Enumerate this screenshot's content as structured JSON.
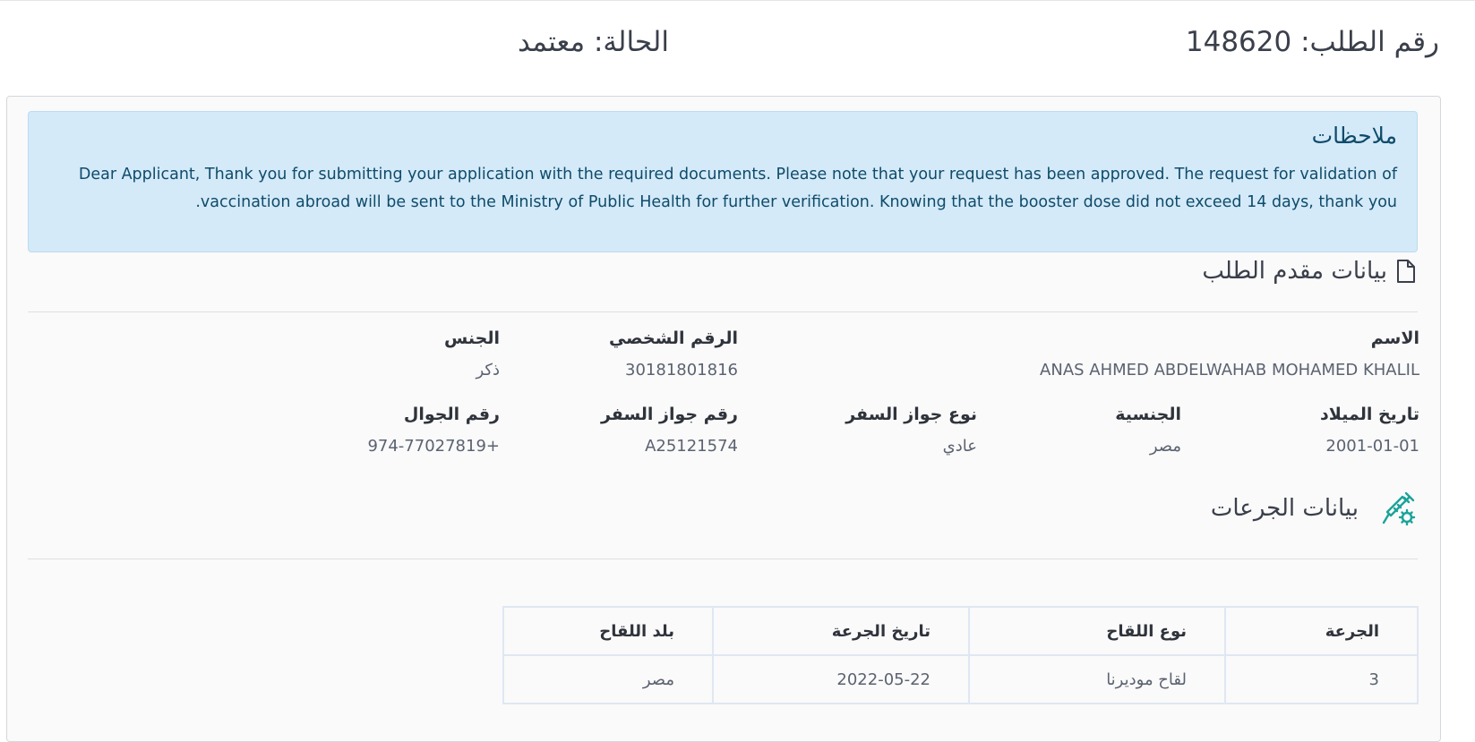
{
  "header": {
    "request_number": "رقم الطلب: 148620",
    "status": "الحالة: معتمد"
  },
  "notes": {
    "title": "ملاحظات",
    "body": "Dear Applicant, Thank you for submitting your application with the required documents. Please note that your request has been approved. The request for validation of vaccination abroad will be sent to the Ministry of Public Health for further verification. Knowing that the booster dose did not exceed 14 days, thank you."
  },
  "applicant": {
    "section_title": "بيانات مقدم الطلب",
    "icon": "document-icon",
    "fields": {
      "name": {
        "label": "الاسم",
        "value": "ANAS AHMED ABDELWAHAB MOHAMED KHALIL"
      },
      "personal_id": {
        "label": "الرقم الشخصي",
        "value": "30181801816"
      },
      "gender": {
        "label": "الجنس",
        "value": "ذكر"
      },
      "birth_date": {
        "label": "تاريخ الميلاد",
        "value": "2001-01-01"
      },
      "nationality": {
        "label": "الجنسية",
        "value": "مصر"
      },
      "passport_type": {
        "label": "نوع جواز السفر",
        "value": "عادي"
      },
      "passport_number": {
        "label": "رقم جواز السفر",
        "value": "A25121574"
      },
      "mobile": {
        "label": "رقم الجوال",
        "value": "+974-77027819"
      }
    }
  },
  "doses": {
    "section_title": "بيانات الجرعات",
    "icon": "syringe-icon",
    "icon_color": "#1aa39a",
    "columns": [
      "الجرعة",
      "نوع اللقاح",
      "تاريخ الجرعة",
      "بلد اللقاح"
    ],
    "rows": [
      [
        "3",
        "لقاح موديرنا",
        "2022-05-22",
        "مصر"
      ]
    ]
  }
}
